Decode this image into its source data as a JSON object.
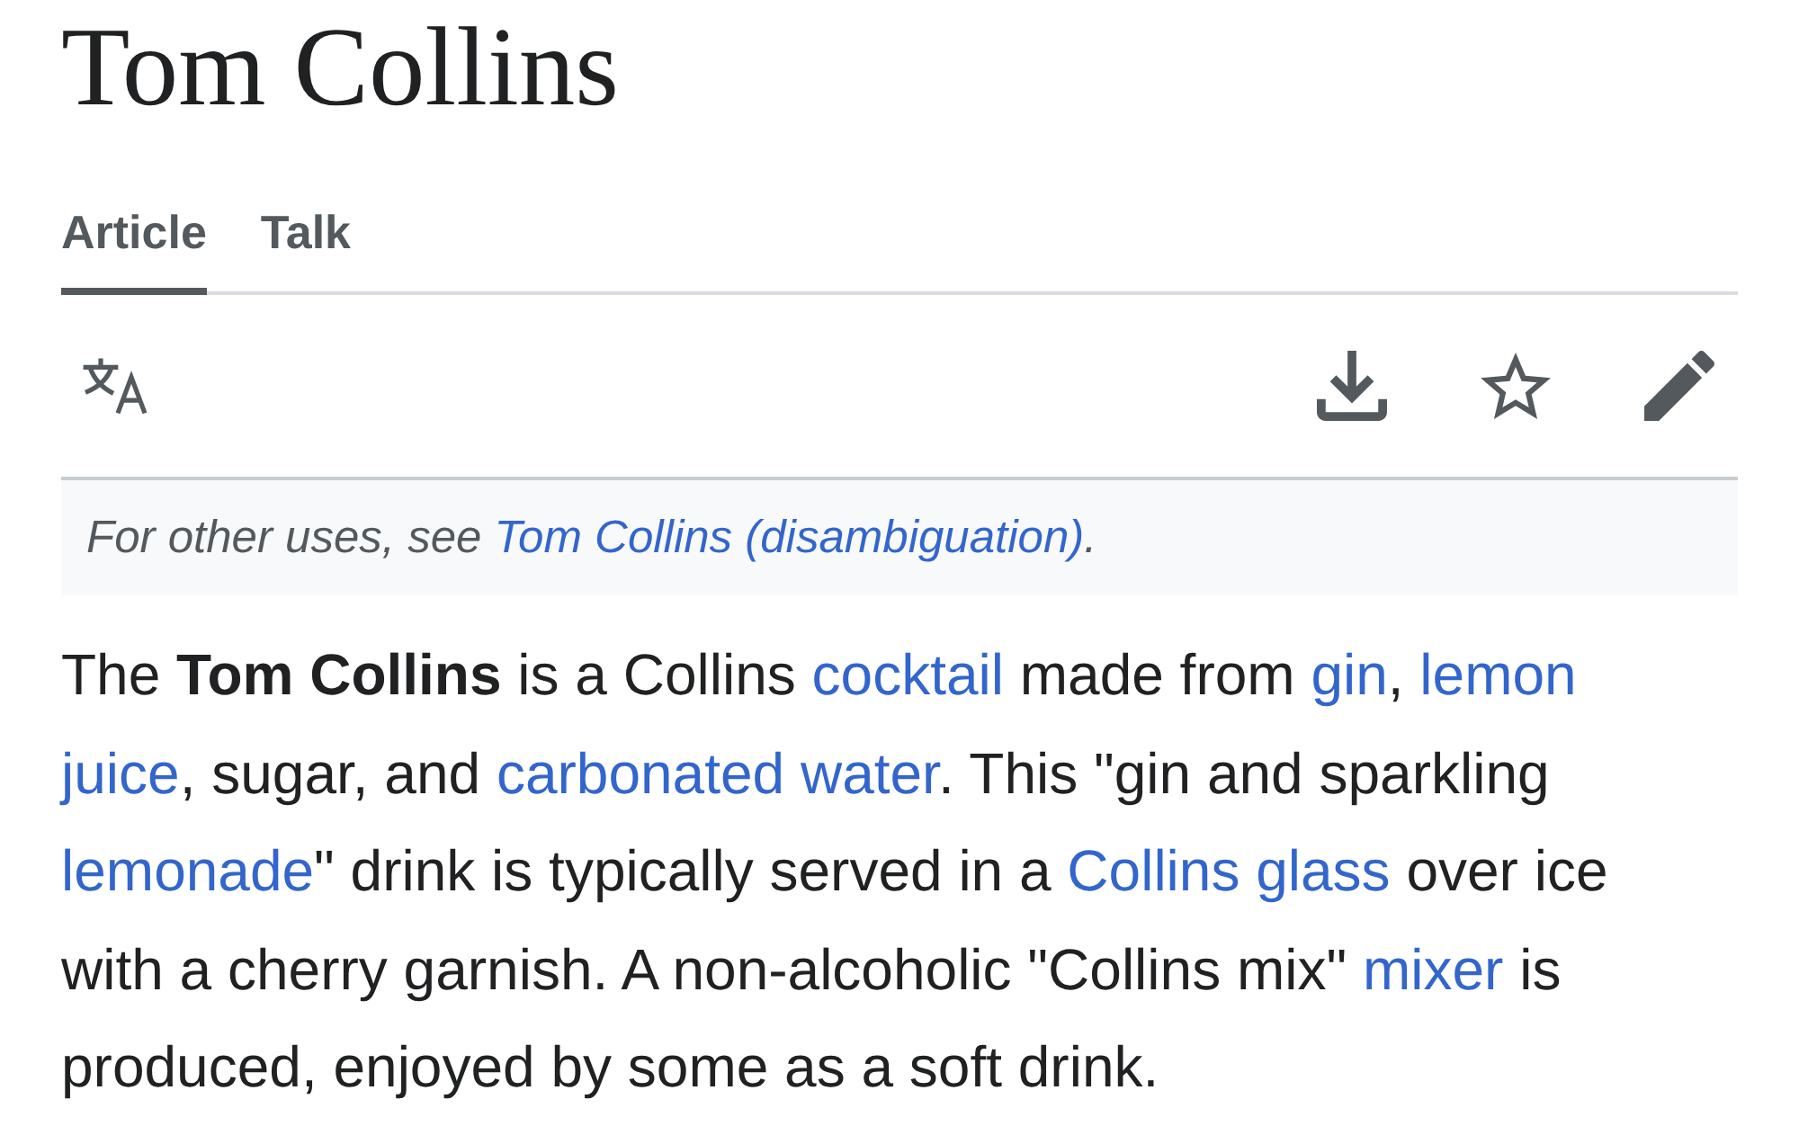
{
  "page": {
    "title": "Tom Collins"
  },
  "tabs": [
    {
      "label": "Article",
      "selected": true
    },
    {
      "label": "Talk",
      "selected": false
    }
  ],
  "toolbar": {
    "watched": false
  },
  "hatnote": [
    {
      "kind": "text",
      "text": "For other uses, see "
    },
    {
      "kind": "link",
      "text": "Tom Collins (disambiguation)"
    },
    {
      "kind": "text",
      "text": "."
    }
  ],
  "paragraph": [
    {
      "kind": "text",
      "text": "The "
    },
    {
      "kind": "bold",
      "text": "Tom Collins"
    },
    {
      "kind": "text",
      "text": " is a Collins "
    },
    {
      "kind": "link",
      "text": "cocktail"
    },
    {
      "kind": "text",
      "text": " made from "
    },
    {
      "kind": "link",
      "text": "gin"
    },
    {
      "kind": "text",
      "text": ", "
    },
    {
      "kind": "wrapping_link",
      "text": "lemon juice"
    },
    {
      "kind": "text",
      "text": ", sugar, and "
    },
    {
      "kind": "link",
      "text": "carbonated water"
    },
    {
      "kind": "text",
      "text": ". This \"gin and sparkling "
    },
    {
      "kind": "link",
      "text": "lemonade"
    },
    {
      "kind": "text",
      "text": "\" drink is typically served in a "
    },
    {
      "kind": "link",
      "text": "Collins glass"
    },
    {
      "kind": "text",
      "text": " over ice with a cherry garnish. A non-alcoholic \"Collins mix\" "
    },
    {
      "kind": "link",
      "text": "mixer"
    },
    {
      "kind": "text",
      "text": " is produced, enjoyed by some as a soft drink."
    }
  ]
}
